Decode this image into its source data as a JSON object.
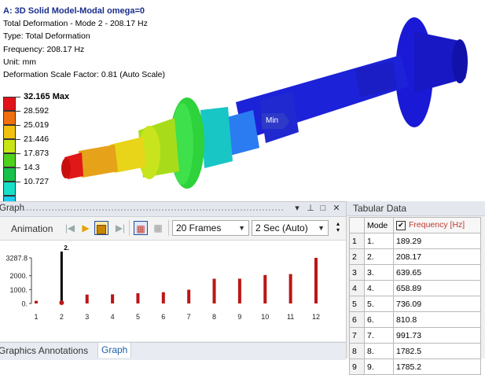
{
  "model": {
    "title": "A: 3D Solid Model-Modal omega=0",
    "lines": [
      "Total Deformation - Mode 2 - 208.17 Hz",
      "Type: Total Deformation",
      "Frequency: 208.17 Hz",
      "Unit: mm",
      "Deformation Scale Factor: 0.81 (Auto Scale)"
    ],
    "min_label": "Min"
  },
  "legend": {
    "entries": [
      {
        "label": "32.165 Max",
        "color": "#e0131b"
      },
      {
        "label": "28.592",
        "color": "#f06f0e"
      },
      {
        "label": "25.019",
        "color": "#f0c20f"
      },
      {
        "label": "21.446",
        "color": "#c8e515"
      },
      {
        "label": "17.873",
        "color": "#4fd01d"
      },
      {
        "label": "14.3",
        "color": "#18c24a"
      },
      {
        "label": "10.727",
        "color": "#17dfc8"
      }
    ],
    "bottom_color": "#19cfef"
  },
  "graph": {
    "title": "Graph",
    "toolbar": {
      "animation_label": "Animation",
      "frames_value": "20 Frames",
      "duration_value": "2 Sec (Auto)"
    },
    "selected_marker": "2.",
    "tabs": [
      "Graphics Annotations",
      "Graph"
    ]
  },
  "chart_data": {
    "type": "bar",
    "categories": [
      "1",
      "2",
      "3",
      "4",
      "5",
      "6",
      "7",
      "8",
      "9",
      "10",
      "11",
      "12"
    ],
    "values": [
      189.29,
      208.17,
      639.65,
      658.89,
      736.09,
      810.8,
      991.73,
      1782.5,
      1785.2,
      2050,
      2120,
      3287.8
    ],
    "ytick_labels": [
      "3287.8",
      "2000.",
      "1000.",
      "0."
    ],
    "ytick_values": [
      3287.8,
      2000,
      1000,
      0
    ],
    "ylim": [
      0,
      3287.8
    ],
    "selected_index": 1,
    "bar_color": "#bb1616",
    "selected_color": "#000000",
    "title": "",
    "xlabel": "",
    "ylabel": ""
  },
  "tabular": {
    "title": "Tabular Data",
    "headers": {
      "mode": "Mode",
      "frequency": "Frequency [Hz]"
    },
    "rows": [
      {
        "n": "1",
        "mode": "1.",
        "freq": "189.29"
      },
      {
        "n": "2",
        "mode": "2.",
        "freq": "208.17"
      },
      {
        "n": "3",
        "mode": "3.",
        "freq": "639.65"
      },
      {
        "n": "4",
        "mode": "4.",
        "freq": "658.89"
      },
      {
        "n": "5",
        "mode": "5.",
        "freq": "736.09"
      },
      {
        "n": "6",
        "mode": "6.",
        "freq": "810.8"
      },
      {
        "n": "7",
        "mode": "7.",
        "freq": "991.73"
      },
      {
        "n": "8",
        "mode": "8.",
        "freq": "1782.5"
      },
      {
        "n": "9",
        "mode": "9.",
        "freq": "1785.2"
      }
    ]
  }
}
